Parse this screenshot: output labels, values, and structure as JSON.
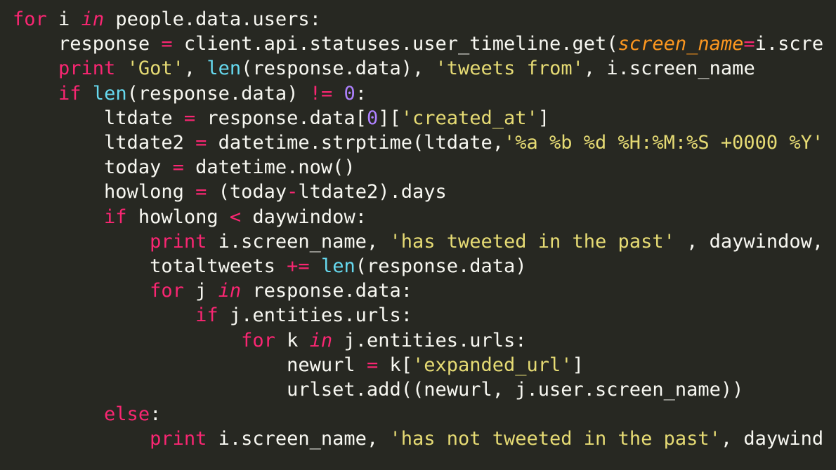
{
  "language": "python",
  "theme": "monokai",
  "indent_size": 4,
  "code": {
    "lines": [
      {
        "indent": 0,
        "tokens": [
          {
            "cls": "kw",
            "t": "for"
          },
          {
            "cls": "nm",
            "t": " i "
          },
          {
            "cls": "kw-i",
            "t": "in"
          },
          {
            "cls": "nm",
            "t": " people.data.users"
          },
          {
            "cls": "pn",
            "t": ":"
          }
        ]
      },
      {
        "indent": 1,
        "tokens": [
          {
            "cls": "nm",
            "t": "response "
          },
          {
            "cls": "op",
            "t": "="
          },
          {
            "cls": "nm",
            "t": " client.api.statuses.user_timeline.get("
          },
          {
            "cls": "arg",
            "t": "screen_name"
          },
          {
            "cls": "op",
            "t": "="
          },
          {
            "cls": "nm",
            "t": "i.scre"
          }
        ]
      },
      {
        "indent": 1,
        "tokens": [
          {
            "cls": "kw",
            "t": "print"
          },
          {
            "cls": "nm",
            "t": " "
          },
          {
            "cls": "str",
            "t": "'Got'"
          },
          {
            "cls": "pn",
            "t": ", "
          },
          {
            "cls": "fn",
            "t": "len"
          },
          {
            "cls": "pn",
            "t": "("
          },
          {
            "cls": "nm",
            "t": "response.data"
          },
          {
            "cls": "pn",
            "t": "), "
          },
          {
            "cls": "str",
            "t": "'tweets from'"
          },
          {
            "cls": "pn",
            "t": ", "
          },
          {
            "cls": "nm",
            "t": "i.screen_name"
          }
        ]
      },
      {
        "indent": 1,
        "tokens": [
          {
            "cls": "kw",
            "t": "if"
          },
          {
            "cls": "nm",
            "t": " "
          },
          {
            "cls": "fn",
            "t": "len"
          },
          {
            "cls": "pn",
            "t": "("
          },
          {
            "cls": "nm",
            "t": "response.data"
          },
          {
            "cls": "pn",
            "t": ") "
          },
          {
            "cls": "op",
            "t": "!="
          },
          {
            "cls": "nm",
            "t": " "
          },
          {
            "cls": "num",
            "t": "0"
          },
          {
            "cls": "pn",
            "t": ":"
          }
        ]
      },
      {
        "indent": 2,
        "tokens": [
          {
            "cls": "nm",
            "t": "ltdate "
          },
          {
            "cls": "op",
            "t": "="
          },
          {
            "cls": "nm",
            "t": " response.data["
          },
          {
            "cls": "num",
            "t": "0"
          },
          {
            "cls": "nm",
            "t": "]["
          },
          {
            "cls": "str",
            "t": "'created_at'"
          },
          {
            "cls": "nm",
            "t": "]"
          }
        ]
      },
      {
        "indent": 2,
        "tokens": [
          {
            "cls": "nm",
            "t": "ltdate2 "
          },
          {
            "cls": "op",
            "t": "="
          },
          {
            "cls": "nm",
            "t": " datetime.strptime(ltdate,"
          },
          {
            "cls": "str",
            "t": "'%a %b %d %H:%M:%S +0000 %Y'"
          }
        ]
      },
      {
        "indent": 2,
        "tokens": [
          {
            "cls": "nm",
            "t": "today "
          },
          {
            "cls": "op",
            "t": "="
          },
          {
            "cls": "nm",
            "t": " datetime.now()"
          }
        ]
      },
      {
        "indent": 2,
        "tokens": [
          {
            "cls": "nm",
            "t": "howlong "
          },
          {
            "cls": "op",
            "t": "="
          },
          {
            "cls": "nm",
            "t": " (today"
          },
          {
            "cls": "op",
            "t": "-"
          },
          {
            "cls": "nm",
            "t": "ltdate2).days"
          }
        ]
      },
      {
        "indent": 2,
        "tokens": [
          {
            "cls": "kw",
            "t": "if"
          },
          {
            "cls": "nm",
            "t": " howlong "
          },
          {
            "cls": "op",
            "t": "<"
          },
          {
            "cls": "nm",
            "t": " daywindow"
          },
          {
            "cls": "pn",
            "t": ":"
          }
        ]
      },
      {
        "indent": 3,
        "tokens": [
          {
            "cls": "kw",
            "t": "print"
          },
          {
            "cls": "nm",
            "t": " i.screen_name"
          },
          {
            "cls": "pn",
            "t": ", "
          },
          {
            "cls": "str",
            "t": "'has tweeted in the past'"
          },
          {
            "cls": "pn",
            "t": " , "
          },
          {
            "cls": "nm",
            "t": "daywindow, "
          }
        ]
      },
      {
        "indent": 3,
        "tokens": [
          {
            "cls": "nm",
            "t": "totaltweets "
          },
          {
            "cls": "op",
            "t": "+="
          },
          {
            "cls": "nm",
            "t": " "
          },
          {
            "cls": "fn",
            "t": "len"
          },
          {
            "cls": "pn",
            "t": "("
          },
          {
            "cls": "nm",
            "t": "response.data"
          },
          {
            "cls": "pn",
            "t": ")"
          }
        ]
      },
      {
        "indent": 3,
        "tokens": [
          {
            "cls": "kw",
            "t": "for"
          },
          {
            "cls": "nm",
            "t": " j "
          },
          {
            "cls": "kw-i",
            "t": "in"
          },
          {
            "cls": "nm",
            "t": " response.data"
          },
          {
            "cls": "pn",
            "t": ":"
          }
        ]
      },
      {
        "indent": 4,
        "tokens": [
          {
            "cls": "kw",
            "t": "if"
          },
          {
            "cls": "nm",
            "t": " j.entities.urls"
          },
          {
            "cls": "pn",
            "t": ":"
          }
        ]
      },
      {
        "indent": 5,
        "tokens": [
          {
            "cls": "kw",
            "t": "for"
          },
          {
            "cls": "nm",
            "t": " k "
          },
          {
            "cls": "kw-i",
            "t": "in"
          },
          {
            "cls": "nm",
            "t": " j.entities.urls"
          },
          {
            "cls": "pn",
            "t": ":"
          }
        ]
      },
      {
        "indent": 6,
        "tokens": [
          {
            "cls": "nm",
            "t": "newurl "
          },
          {
            "cls": "op",
            "t": "="
          },
          {
            "cls": "nm",
            "t": " k["
          },
          {
            "cls": "str",
            "t": "'expanded_url'"
          },
          {
            "cls": "nm",
            "t": "]"
          }
        ]
      },
      {
        "indent": 6,
        "tokens": [
          {
            "cls": "nm",
            "t": "urlset.add((newurl, j.user.screen_name))"
          }
        ]
      },
      {
        "indent": 2,
        "tokens": [
          {
            "cls": "kw",
            "t": "else"
          },
          {
            "cls": "pn",
            "t": ":"
          }
        ]
      },
      {
        "indent": 3,
        "tokens": [
          {
            "cls": "kw",
            "t": "print"
          },
          {
            "cls": "nm",
            "t": " i.screen_name"
          },
          {
            "cls": "pn",
            "t": ", "
          },
          {
            "cls": "str",
            "t": "'has not tweeted in the past'"
          },
          {
            "cls": "pn",
            "t": ", "
          },
          {
            "cls": "nm",
            "t": "daywind"
          }
        ]
      }
    ]
  }
}
